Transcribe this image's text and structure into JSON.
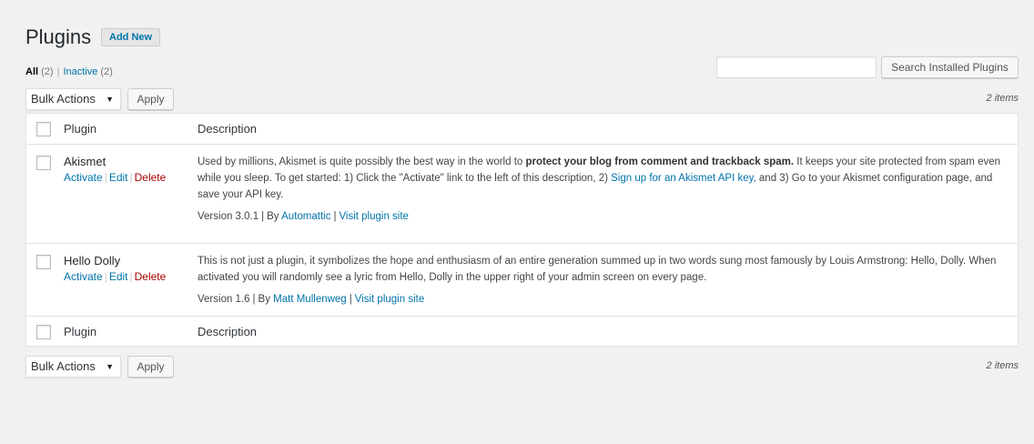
{
  "header": {
    "title": "Plugins",
    "add_new": "Add New"
  },
  "filters": {
    "all_label": "All",
    "all_count": "(2)",
    "separator": "|",
    "inactive_label": "Inactive",
    "inactive_count": "(2)"
  },
  "search": {
    "value": "",
    "button": "Search Installed Plugins"
  },
  "bulk": {
    "selected": "Bulk Actions",
    "apply": "Apply",
    "items": "2 items"
  },
  "table": {
    "col_plugin": "Plugin",
    "col_description": "Description",
    "plugins": [
      {
        "name": "Akismet",
        "actions": {
          "activate": "Activate",
          "edit": "Edit",
          "delete": "Delete"
        },
        "desc_pre": "Used by millions, Akismet is quite possibly the best way in the world to ",
        "desc_bold": "protect your blog from comment and trackback spam.",
        "desc_mid": " It keeps your site protected from spam even while you sleep. To get started: 1) Click the \"Activate\" link to the left of this description, 2) ",
        "desc_link": "Sign up for an Akismet API key,",
        "desc_post": " and 3) Go to your Akismet configuration page, and save your API key.",
        "version": "Version 3.0.1",
        "by": "By",
        "author": "Automattic",
        "site_link": "Visit plugin site"
      },
      {
        "name": "Hello Dolly",
        "actions": {
          "activate": "Activate",
          "edit": "Edit",
          "delete": "Delete"
        },
        "desc_pre": "This is not just a plugin, it symbolizes the hope and enthusiasm of an entire generation summed up in two words sung most famously by Louis Armstrong: Hello, Dolly. When activated you will randomly see a lyric from Hello, Dolly in the upper right of your admin screen on every page.",
        "version": "Version 1.6",
        "by": "By",
        "author": "Matt Mullenweg",
        "site_link": "Visit plugin site"
      }
    ]
  },
  "colors": {
    "link": "#0073aa",
    "delete": "#aa0000",
    "background": "#f1f1f1"
  },
  "icons": {
    "dropdown": "caret-down-icon"
  }
}
